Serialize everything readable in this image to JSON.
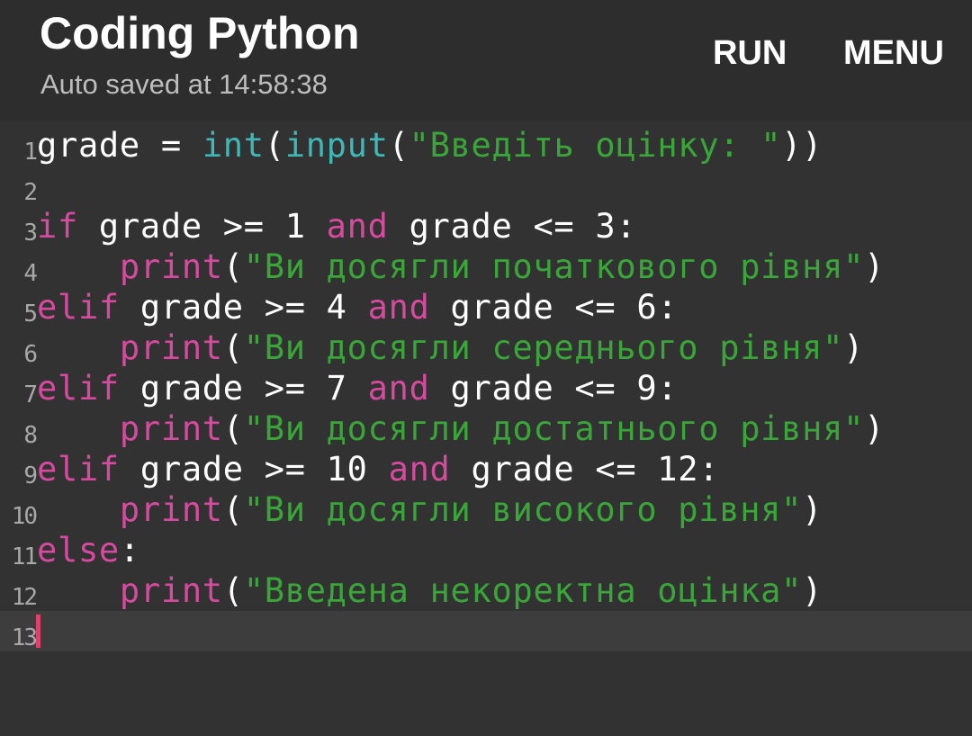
{
  "header": {
    "title": "Coding Python",
    "subtitle": "Auto saved at 14:58:38",
    "run_label": "RUN",
    "menu_label": "MENU"
  },
  "editor": {
    "current_line": "13",
    "lines": [
      {
        "num": "1",
        "tokens": [
          {
            "t": "grade = ",
            "c": "plain"
          },
          {
            "t": "int",
            "c": "fn"
          },
          {
            "t": "(",
            "c": "plain"
          },
          {
            "t": "input",
            "c": "fn"
          },
          {
            "t": "(",
            "c": "plain"
          },
          {
            "t": "\"Введіть оцінку: \"",
            "c": "str"
          },
          {
            "t": "))",
            "c": "plain"
          }
        ]
      },
      {
        "num": "2",
        "tokens": []
      },
      {
        "num": "3",
        "tokens": [
          {
            "t": "if",
            "c": "kw"
          },
          {
            "t": " grade >= 1 ",
            "c": "plain"
          },
          {
            "t": "and",
            "c": "kw"
          },
          {
            "t": " grade <= 3:",
            "c": "plain"
          }
        ]
      },
      {
        "num": "4",
        "tokens": [
          {
            "t": "    ",
            "c": "plain"
          },
          {
            "t": "print",
            "c": "kw"
          },
          {
            "t": "(",
            "c": "plain"
          },
          {
            "t": "\"Ви досягли початкового рівня\"",
            "c": "str"
          },
          {
            "t": ")",
            "c": "plain"
          }
        ]
      },
      {
        "num": "5",
        "tokens": [
          {
            "t": "elif",
            "c": "kw"
          },
          {
            "t": " grade >= 4 ",
            "c": "plain"
          },
          {
            "t": "and",
            "c": "kw"
          },
          {
            "t": " grade <= 6:",
            "c": "plain"
          }
        ]
      },
      {
        "num": "6",
        "tokens": [
          {
            "t": "    ",
            "c": "plain"
          },
          {
            "t": "print",
            "c": "kw"
          },
          {
            "t": "(",
            "c": "plain"
          },
          {
            "t": "\"Ви досягли середнього рівня\"",
            "c": "str"
          },
          {
            "t": ")",
            "c": "plain"
          }
        ]
      },
      {
        "num": "7",
        "tokens": [
          {
            "t": "elif",
            "c": "kw"
          },
          {
            "t": " grade >= 7 ",
            "c": "plain"
          },
          {
            "t": "and",
            "c": "kw"
          },
          {
            "t": " grade <= 9:",
            "c": "plain"
          }
        ]
      },
      {
        "num": "8",
        "tokens": [
          {
            "t": "    ",
            "c": "plain"
          },
          {
            "t": "print",
            "c": "kw"
          },
          {
            "t": "(",
            "c": "plain"
          },
          {
            "t": "\"Ви досягли достатнього рівня\"",
            "c": "str"
          },
          {
            "t": ")",
            "c": "plain"
          }
        ]
      },
      {
        "num": "9",
        "tokens": [
          {
            "t": "elif",
            "c": "kw"
          },
          {
            "t": " grade >= 10 ",
            "c": "plain"
          },
          {
            "t": "and",
            "c": "kw"
          },
          {
            "t": " grade <= 12:",
            "c": "plain"
          }
        ]
      },
      {
        "num": "10",
        "tokens": [
          {
            "t": "    ",
            "c": "plain"
          },
          {
            "t": "print",
            "c": "kw"
          },
          {
            "t": "(",
            "c": "plain"
          },
          {
            "t": "\"Ви досягли високого рівня\"",
            "c": "str"
          },
          {
            "t": ")",
            "c": "plain"
          }
        ]
      },
      {
        "num": "11",
        "tokens": [
          {
            "t": "else",
            "c": "kw"
          },
          {
            "t": ":",
            "c": "plain"
          }
        ]
      },
      {
        "num": "12",
        "tokens": [
          {
            "t": "    ",
            "c": "plain"
          },
          {
            "t": "print",
            "c": "kw"
          },
          {
            "t": "(",
            "c": "plain"
          },
          {
            "t": "\"Введена некоректна оцінка\"",
            "c": "str"
          },
          {
            "t": ")",
            "c": "plain"
          }
        ]
      },
      {
        "num": "13",
        "tokens": []
      }
    ]
  },
  "colors": {
    "keyword": "#d64a9f",
    "builtin": "#3fb8b8",
    "string": "#3aa63a",
    "caret": "#e0406e",
    "background": "#323232"
  }
}
